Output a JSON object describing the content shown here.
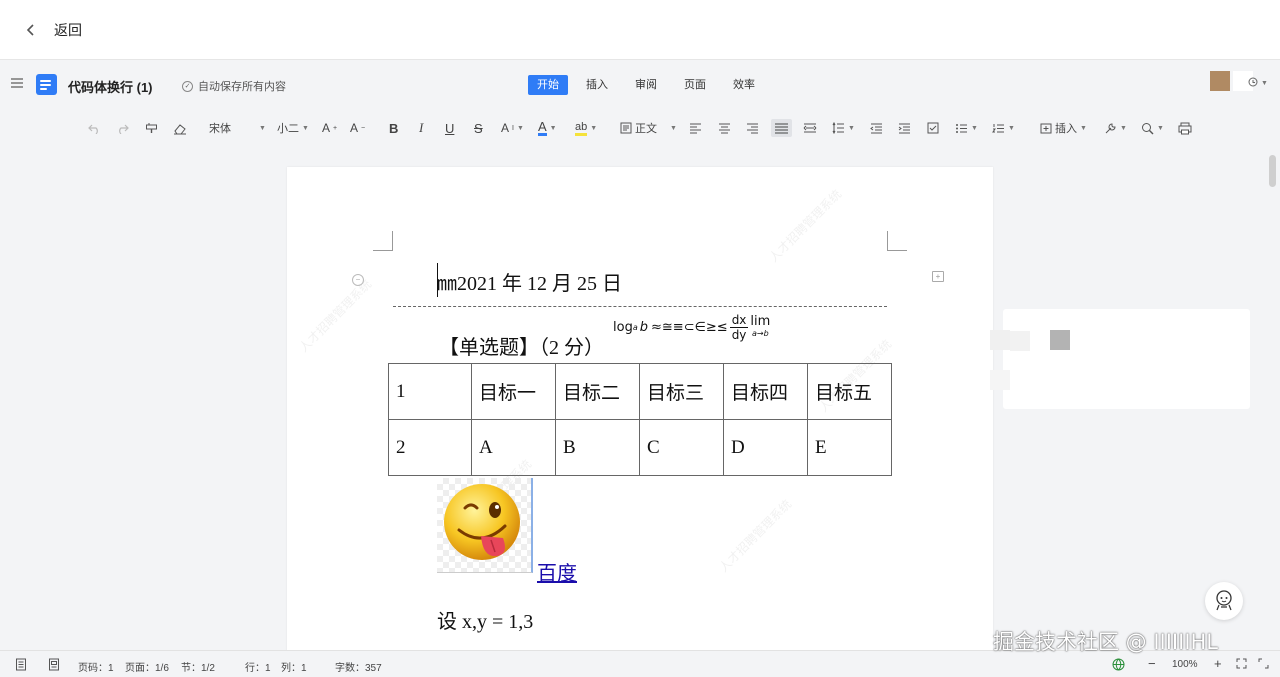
{
  "topbar": {
    "back_label": "返回"
  },
  "header": {
    "doc_title": "代码体换行 (1)",
    "autosave": "自动保存所有内容",
    "tabs": [
      {
        "label": "开始",
        "active": true
      },
      {
        "label": "插入",
        "active": false
      },
      {
        "label": "审阅",
        "active": false
      },
      {
        "label": "页面",
        "active": false
      },
      {
        "label": "效率",
        "active": false
      }
    ],
    "accent_color": "#2f7cf6"
  },
  "toolbar": {
    "font_name": "宋体",
    "font_size": "小二",
    "paragraph_style": "正文",
    "insert_label": "插入"
  },
  "document": {
    "date_line": "㎜2021 年 12 月 25 日",
    "question": "【单选题】（2 分）",
    "formula": {
      "log": "log",
      "log_sub": "a",
      "log_arg": "b",
      "symbols": "≈≅≡⊂∈≥≤",
      "frac_num": "dx",
      "frac_den": "dy",
      "lim": "lim",
      "lim_sub": "a→b"
    },
    "table": [
      [
        "1",
        "目标一",
        "目标二",
        "目标三",
        "目标四",
        "目标五"
      ],
      [
        "2",
        "A",
        "B",
        "C",
        "D",
        "E"
      ]
    ],
    "link": "百度",
    "equation": "设 x,y = 1,3"
  },
  "statusbar": {
    "page_code": "页码：1",
    "page": "页面：1/6",
    "section": "节：1/2",
    "row": "行：1",
    "col": "列：1",
    "word_count": "字数：357",
    "zoom": "100%"
  },
  "overlay": {
    "watermark": "掘金技术社区 @ IIIIIIHL"
  }
}
